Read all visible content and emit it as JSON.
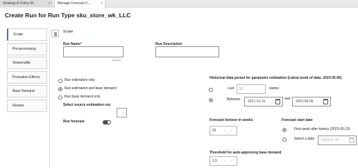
{
  "tabs": [
    {
      "label": "Strategy & Policy M...",
      "close": "×"
    },
    {
      "label": "Manage Forecast C...",
      "close": "×"
    }
  ],
  "page_title": "Create Run for Run Type sku_store_wk_LLC",
  "sidebar": {
    "items": [
      {
        "label": "Scope"
      },
      {
        "label": "Pre-processing"
      },
      {
        "label": "Seasonality"
      },
      {
        "label": "Promotion Effects"
      },
      {
        "label": "Base Demand"
      },
      {
        "label": "Review"
      }
    ]
  },
  "section_label": "Scope",
  "run_name": {
    "label": "Run Name",
    "required_mark": "*",
    "value": "",
    "hint": "Required"
  },
  "run_description": {
    "label": "Run Description",
    "value": ""
  },
  "run_type_options": {
    "estimation_only": "Run estimation only",
    "estimation_and_base": "Run estimation and base demand",
    "base_only": "Run base demand only"
  },
  "source_run": {
    "label": "Select source estimation run",
    "value": "",
    "caret": "⌄"
  },
  "run_forecast": {
    "label": "Run forecast"
  },
  "historical": {
    "title": "Historical data period for parameter estimation (Latest week of data: 2023-05-06)",
    "last_label": "Last",
    "last_value": "52",
    "weeks_label": "weeks",
    "between_label": "Between",
    "start_date": "2021-01-31",
    "and_label": "and",
    "end_date": "2023-05-06"
  },
  "forecast_horizon": {
    "label": "Forecast horizon in weeks",
    "value": "52"
  },
  "forecast_start": {
    "label": "Forecast start date",
    "first_week_label": "First week after history (2023-05-13)",
    "select_date_label": "Select a date",
    "date_value": "2018-07-22"
  },
  "threshold": {
    "label": "Threshold for auto-approving base demand",
    "value": "1.5"
  },
  "stepper_arrows": {
    "down": "⌄",
    "up": "^"
  },
  "colors": {
    "accent": "#5b6f86",
    "toggle": "#4a4a4a"
  }
}
